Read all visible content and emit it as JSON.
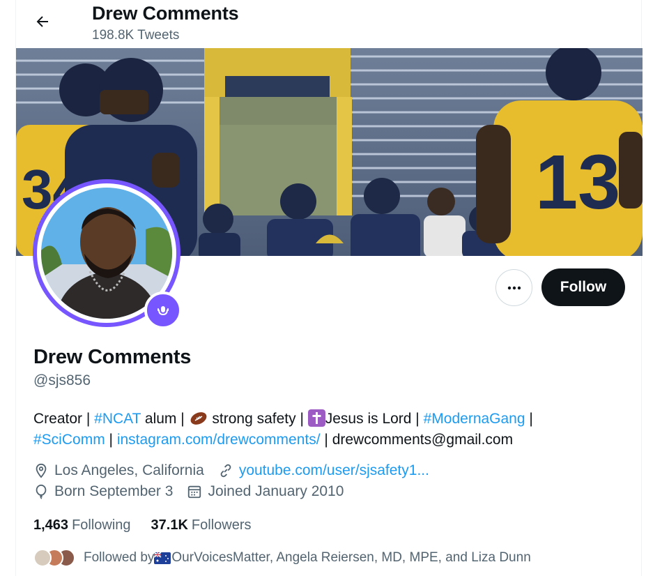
{
  "header": {
    "name": "Drew Comments",
    "tweet_count": "198.8K Tweets"
  },
  "banner": {
    "jersey_number": "13",
    "jersey_number_left": "34"
  },
  "actions": {
    "follow_label": "Follow"
  },
  "profile": {
    "name": "Drew Comments",
    "handle": "@sjs856"
  },
  "bio": {
    "t1": "Creator | ",
    "tag_ncat": "#NCAT",
    "t2": " alum | ",
    "t3": " strong safety | ",
    "t4": "Jesus is Lord | ",
    "tag_moderna": "#ModernaGang",
    "t5": " |",
    "tag_scicomm": "#SciComm",
    "t6": " | ",
    "link_instagram": "instagram.com/drewcomments/",
    "t7": " | drewcomments@gmail.com",
    "emoji_1": "american-football-emoji",
    "emoji_2": "latin-cross-emoji"
  },
  "meta": {
    "location": "Los Angeles, California",
    "website": "youtube.com/user/sjsafety1...",
    "birthday": "Born September 3",
    "joined": "Joined January 2010"
  },
  "stats": {
    "following_count": "1,463",
    "following_label": "Following",
    "followers_count": "37.1K",
    "followers_label": "Followers"
  },
  "followed_by": {
    "prefix": "Followed by ",
    "names": "OurVoicesMatter, Angela Reiersen, MD, MPE, and Liza Dunn",
    "flag": "australia-flag-emoji"
  },
  "colors": {
    "accent": "#1d9bf0",
    "spaces_ring": "#7856ff",
    "follow_button": "#0f1419",
    "secondary_text": "#536471"
  }
}
